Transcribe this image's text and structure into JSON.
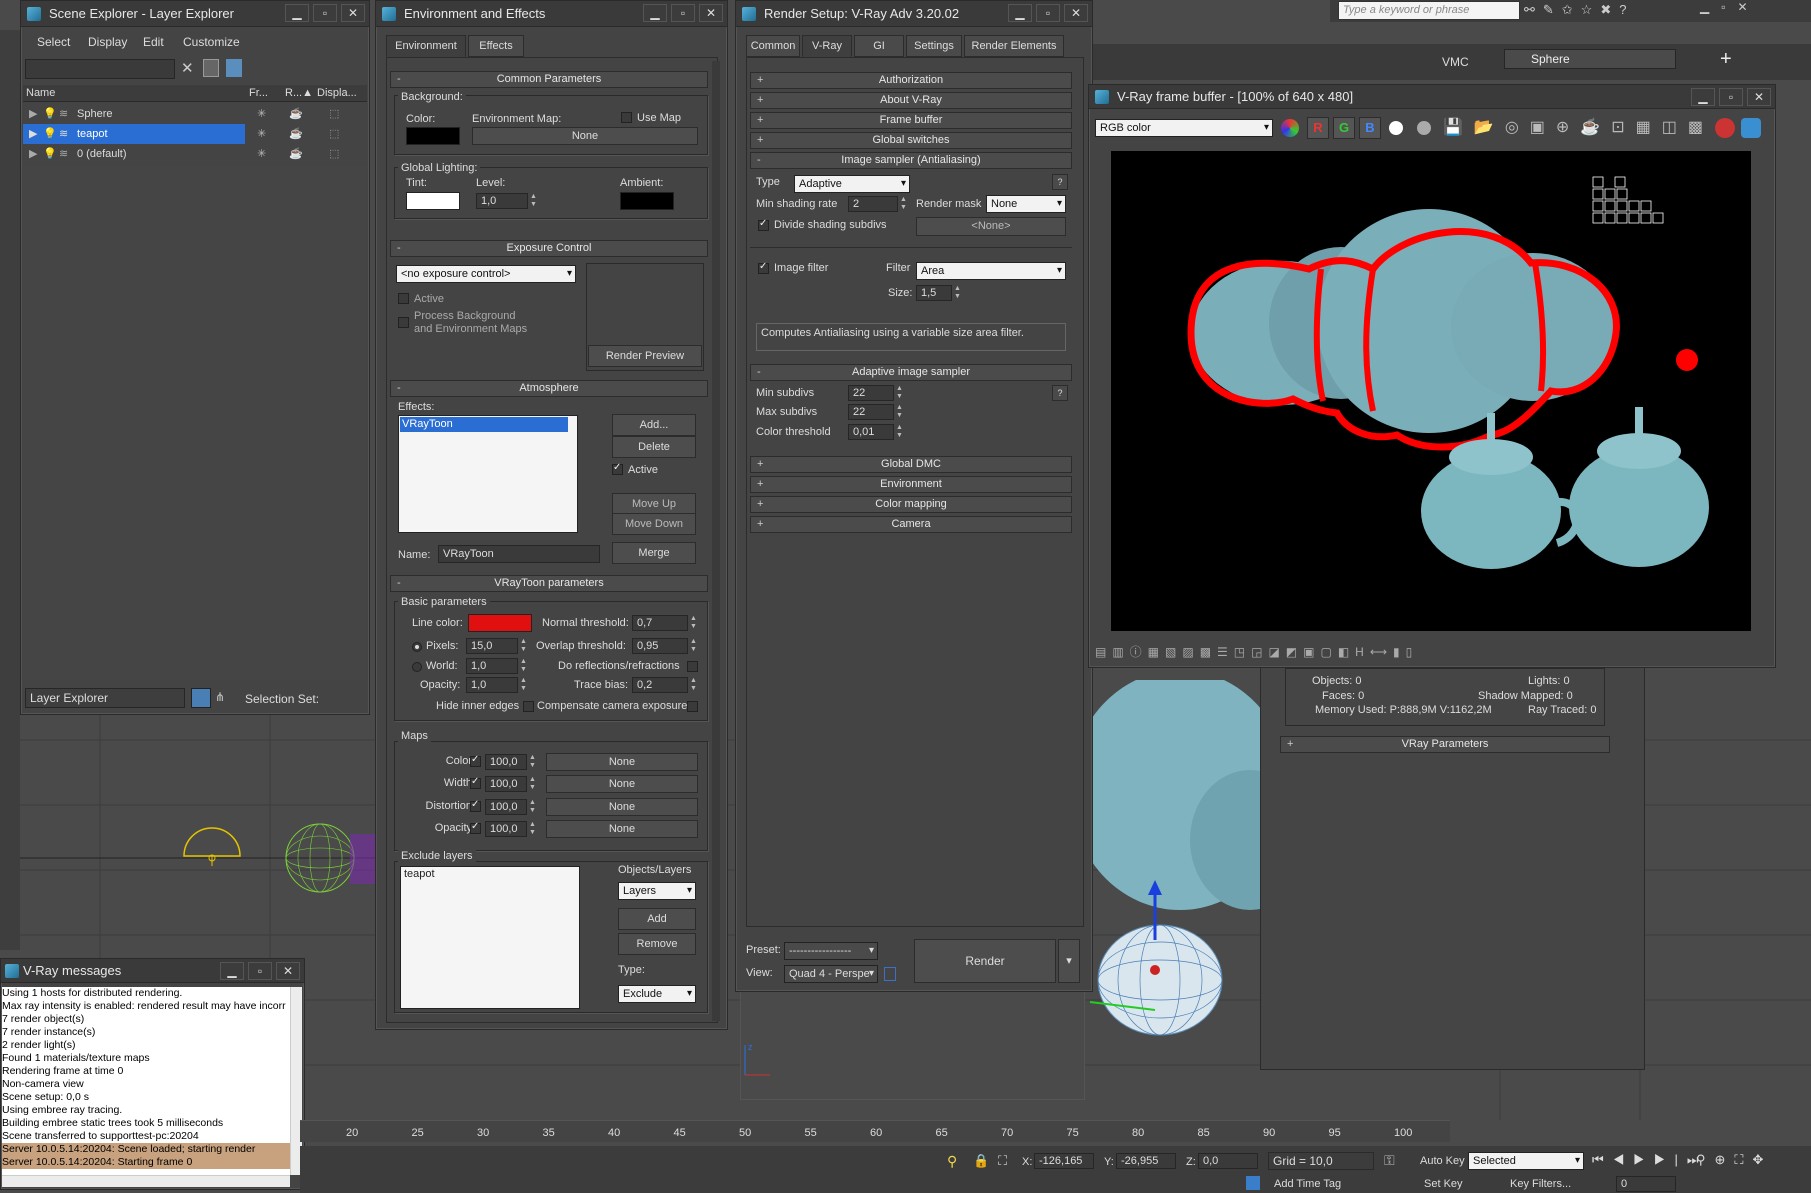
{
  "topbar": {
    "search_placeholder": "Type a keyword or phrase",
    "vmc_label": "VMC",
    "selection_dropdown": "Sphere"
  },
  "scene_explorer": {
    "title": "Scene Explorer - Layer Explorer",
    "menu": [
      "Select",
      "Display",
      "Edit",
      "Customize"
    ],
    "columns": [
      "Name",
      "Fr...",
      "R...▲",
      "Displa..."
    ],
    "rows": [
      {
        "name": "Sphere"
      },
      {
        "name": "teapot"
      },
      {
        "name": "0 (default)"
      }
    ],
    "footer_dropdown": "Layer Explorer",
    "selection_set_label": "Selection Set:"
  },
  "vray_messages": {
    "title": "V-Ray messages",
    "lines": [
      "Using 1 hosts for distributed rendering.",
      "Max ray intensity is enabled: rendered result may have incorr",
      "7 render object(s)",
      "7 render instance(s)",
      "2 render light(s)",
      "Found 1 materials/texture maps",
      "Rendering frame at time 0",
      "Non-camera view",
      "Scene setup: 0,0 s",
      "Using embree ray tracing.",
      "Building embree static trees took 5 milliseconds",
      "Scene transferred to supporttest-pc:20204"
    ],
    "highlight_lines": [
      "Server 10.0.5.14:20204: Scene loaded; starting render",
      "Server 10.0.5.14:20204: Starting frame 0"
    ]
  },
  "env_effects": {
    "title": "Environment and Effects",
    "tabs": [
      "Environment",
      "Effects"
    ],
    "common_params_title": "Common Parameters",
    "background_label": "Background:",
    "color_label": "Color:",
    "env_map_label": "Environment Map:",
    "use_map_label": "Use Map",
    "none_label": "None",
    "global_lighting_label": "Global Lighting:",
    "tint_label": "Tint:",
    "level_label": "Level:",
    "level_value": "1,0",
    "ambient_label": "Ambient:",
    "exposure_title": "Exposure Control",
    "exposure_dropdown": "<no exposure control>",
    "active_label": "Active",
    "process_bg_label_1": "Process Background",
    "process_bg_label_2": "and Environment Maps",
    "render_preview": "Render Preview",
    "atmosphere_title": "Atmosphere",
    "effects_label": "Effects:",
    "effect_item": "VRayToon",
    "add_btn": "Add...",
    "delete_btn": "Delete",
    "active_chk": "Active",
    "move_up": "Move Up",
    "move_down": "Move Down",
    "name_label": "Name:",
    "name_value": "VRayToon",
    "merge_btn": "Merge",
    "vraytoon_title": "VRayToon parameters",
    "basic_params": "Basic parameters",
    "line_color_label": "Line color:",
    "line_color": "#e11010",
    "normal_threshold_label": "Normal threshold:",
    "normal_threshold": "0,7",
    "pixels_label": "Pixels:",
    "pixels_value": "15,0",
    "overlap_threshold_label": "Overlap threshold:",
    "overlap_threshold": "0,95",
    "world_label": "World:",
    "world_value": "1,0",
    "do_reflections_label": "Do reflections/refractions",
    "opacity_label": "Opacity:",
    "opacity_value": "1,0",
    "trace_bias_label": "Trace bias:",
    "trace_bias": "0,2",
    "hide_inner_edges": "Hide inner edges",
    "compensate_exposure": "Compensate camera exposure",
    "maps_label": "Maps",
    "maps": [
      {
        "label": "Color",
        "value": "100,0",
        "map": "None"
      },
      {
        "label": "Width",
        "value": "100,0",
        "map": "None"
      },
      {
        "label": "Distortion",
        "value": "100,0",
        "map": "None"
      },
      {
        "label": "Opacity",
        "value": "100,0",
        "map": "None"
      }
    ],
    "exclude_layers_label": "Exclude layers",
    "exclude_item": "teapot",
    "objects_layers_label": "Objects/Layers",
    "layers_dropdown": "Layers",
    "add_btn2": "Add",
    "remove_btn": "Remove",
    "type_label": "Type:",
    "type_dropdown": "Exclude"
  },
  "render_setup": {
    "title": "Render Setup: V-Ray Adv 3.20.02",
    "tabs": [
      "Common",
      "V-Ray",
      "GI",
      "Settings",
      "Render Elements"
    ],
    "rollouts_top": [
      "Authorization",
      "About V-Ray",
      "Frame buffer",
      "Global switches"
    ],
    "image_sampler_title": "Image sampler (Antialiasing)",
    "type_label": "Type",
    "type_value": "Adaptive",
    "min_shading_label": "Min shading rate",
    "min_shading_value": "2",
    "render_mask_label": "Render mask",
    "render_mask_value": "None",
    "divide_shading": "Divide shading subdivs",
    "none_button": "<None>",
    "image_filter_label": "Image filter",
    "filter_label": "Filter",
    "filter_value": "Area",
    "size_label": "Size:",
    "size_value": "1,5",
    "filter_desc": "Computes Antialiasing using a variable size area filter.",
    "adaptive_title": "Adaptive image sampler",
    "min_subdivs_label": "Min subdivs",
    "min_subdivs": "22",
    "max_subdivs_label": "Max subdivs",
    "max_subdivs": "22",
    "color_threshold_label": "Color threshold",
    "color_threshold": "0,01",
    "rollouts_bottom": [
      "Global DMC",
      "Environment",
      "Color mapping",
      "Camera"
    ],
    "preset_label": "Preset:",
    "preset_value": "-----------------",
    "view_label": "View:",
    "view_value": "Quad 4 - Perspe",
    "render_btn": "Render"
  },
  "frame_buffer": {
    "title": "V-Ray frame buffer - [100% of 640 x 480]",
    "channel_dropdown": "RGB color",
    "channel_buttons": [
      "R",
      "G",
      "B"
    ]
  },
  "right_panel": {
    "objects_label": "Objects: 0",
    "lights_label": "Lights: 0",
    "faces_label": "Faces: 0",
    "shadow_label": "Shadow Mapped: 0",
    "memory_label": "Memory Used: P:888,9M V:1162,2M",
    "ray_traced_label": "Ray Traced: 0",
    "vray_params": "VRay Parameters"
  },
  "timeline": {
    "ticks": [
      "20",
      "25",
      "30",
      "35",
      "40",
      "45",
      "50",
      "55",
      "60",
      "65",
      "70",
      "75",
      "80",
      "85",
      "90",
      "95",
      "100"
    ]
  },
  "statusbar": {
    "x_label": "X:",
    "x_value": "-126,165",
    "y_label": "Y:",
    "y_value": "-26,955",
    "z_label": "Z:",
    "z_value": "0,0",
    "grid": "Grid = 10,0",
    "add_time_tag": "Add Time Tag",
    "auto_key": "Auto Key",
    "selected_dropdown": "Selected",
    "set_key": "Set Key",
    "key_filters": "Key Filters...",
    "frame_value": "0"
  }
}
